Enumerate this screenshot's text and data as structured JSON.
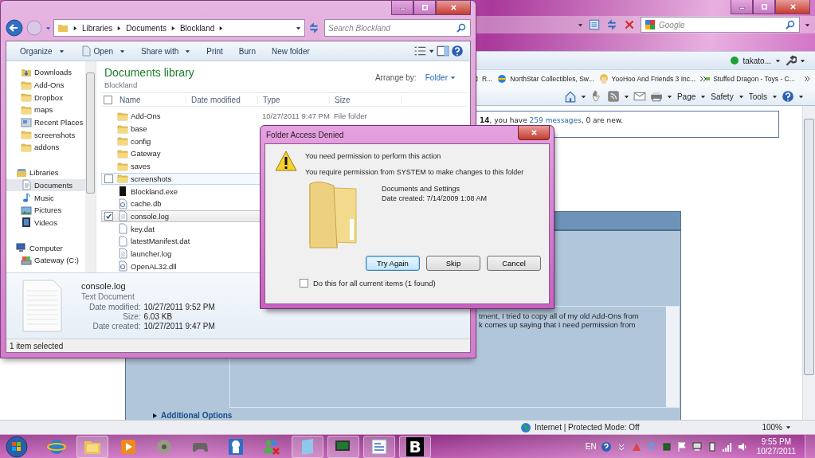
{
  "browser": {
    "search": {
      "placeholder": "Google"
    },
    "user": {
      "name": "takato...",
      "online": true
    },
    "favorites": [
      {
        "label": "R...",
        "kind": "page"
      },
      {
        "label": "NorthStar Collectibles, Sw...",
        "kind": "page"
      },
      {
        "label": "YooHoo And Friends 3 Inc...",
        "kind": "avatar"
      },
      {
        "label": "Stuffed Dragon - Toys - C...",
        "kind": "shop"
      }
    ],
    "command_bar": [
      "Page",
      "Safety",
      "Tools"
    ],
    "welcome": {
      "text": "**14**, you have ",
      "link": "259 messages",
      "rest": ", 0 are new."
    },
    "message_lines": [
      "tment, I tried to copy all of my old Add-Ons from",
      "k comes up saying that I need permission from"
    ],
    "additional_options": "Additional Options",
    "status": {
      "zone": "Internet | Protected Mode: Off",
      "zoom": "100%"
    }
  },
  "explorer": {
    "breadcrumb": [
      "Libraries",
      "Documents",
      "Blockland"
    ],
    "search": {
      "placeholder": "Search Blockland"
    },
    "toolbar": [
      {
        "label": "Organize",
        "dropdown": true,
        "icon": false
      },
      {
        "label": "Open",
        "dropdown": true,
        "icon": true
      },
      {
        "label": "Share with",
        "dropdown": true,
        "icon": false
      },
      {
        "label": "Print",
        "dropdown": false,
        "icon": false
      },
      {
        "label": "Burn",
        "dropdown": false,
        "icon": false
      },
      {
        "label": "New folder",
        "dropdown": false,
        "icon": false
      }
    ],
    "favorites": [
      {
        "label": "Downloads",
        "kind": "downloads",
        "selected": false
      },
      {
        "label": "Add-Ons",
        "kind": "folder",
        "selected": false
      },
      {
        "label": "Dropbox",
        "kind": "folder",
        "selected": false
      },
      {
        "label": "maps",
        "kind": "folder",
        "selected": false
      },
      {
        "label": "Recent Places",
        "kind": "recent",
        "selected": false
      },
      {
        "label": "screenshots",
        "kind": "folder",
        "selected": false
      },
      {
        "label": "addons",
        "kind": "folder",
        "selected": false
      }
    ],
    "groups": [
      {
        "label": "Libraries",
        "kind": "libraries",
        "children": [
          {
            "label": "Documents",
            "kind": "documents",
            "selected": true
          },
          {
            "label": "Music",
            "kind": "music",
            "selected": false
          },
          {
            "label": "Pictures",
            "kind": "pictures",
            "selected": false
          },
          {
            "label": "Videos",
            "kind": "videos",
            "selected": false
          }
        ]
      },
      {
        "label": "Computer",
        "kind": "computer",
        "children": [
          {
            "label": "Gateway (C:)",
            "kind": "drive",
            "selected": false
          }
        ]
      }
    ],
    "library": {
      "title": "Documents library",
      "subtitle": "Blockland",
      "arrange_label": "Arrange by:",
      "arrange_value": "Folder"
    },
    "columns": [
      "Name",
      "Date modified",
      "Type",
      "Size"
    ],
    "select_all_checked": false,
    "files": [
      {
        "name": "Add-Ons",
        "kind": "folder",
        "date": "10/27/2011 9:47 PM",
        "type": "File folder",
        "hovered": false,
        "selected": false
      },
      {
        "name": "base",
        "kind": "folder",
        "hovered": false,
        "selected": false
      },
      {
        "name": "config",
        "kind": "folder",
        "hovered": false,
        "selected": false
      },
      {
        "name": "Gateway",
        "kind": "folder",
        "hovered": false,
        "selected": false
      },
      {
        "name": "saves",
        "kind": "folder",
        "hovered": false,
        "selected": false
      },
      {
        "name": "screenshots",
        "kind": "folder",
        "hovered": true,
        "selected": false
      },
      {
        "name": "Blockland.exe",
        "kind": "exe",
        "hovered": false,
        "selected": false
      },
      {
        "name": "cache.db",
        "kind": "system",
        "hovered": false,
        "selected": false
      },
      {
        "name": "console.log",
        "kind": "text",
        "hovered": false,
        "selected": true
      },
      {
        "name": "key.dat",
        "kind": "blank",
        "hovered": false,
        "selected": false
      },
      {
        "name": "latestManifest.dat",
        "kind": "blank",
        "hovered": false,
        "selected": false
      },
      {
        "name": "launcher.log",
        "kind": "text",
        "hovered": false,
        "selected": false
      },
      {
        "name": "OpenAL32.dll",
        "kind": "system",
        "hovered": false,
        "selected": false
      }
    ],
    "details": {
      "name": "console.log",
      "type": "Text Document",
      "props": [
        {
          "label": "Date modified:",
          "value": "10/27/2011 9:52 PM"
        },
        {
          "label": "Size:",
          "value": "6.03 KB"
        },
        {
          "label": "Date created:",
          "value": "10/27/2011 9:47 PM"
        }
      ]
    },
    "status": "1 item selected"
  },
  "dialog": {
    "title": "Folder Access Denied",
    "heading": "You need permission to perform this action",
    "message": "You require permission from SYSTEM to make changes to this folder",
    "item": {
      "name": "Documents and Settings",
      "date": "Date created: 7/14/2009 1:08 AM"
    },
    "buttons": [
      {
        "label": "Try Again",
        "default": true
      },
      {
        "label": "Skip",
        "default": false
      },
      {
        "label": "Cancel",
        "default": false
      }
    ],
    "checkbox": {
      "label": "Do this for all current items (1 found)",
      "checked": false
    }
  },
  "taskbar": {
    "apps": [
      {
        "kind": "ie",
        "running": false
      },
      {
        "kind": "explorer",
        "running": true
      },
      {
        "kind": "media",
        "running": false
      },
      {
        "kind": "disc",
        "running": false
      },
      {
        "kind": "gamepad",
        "running": false
      },
      {
        "kind": "character",
        "running": false
      },
      {
        "kind": "messenger",
        "running": false
      },
      {
        "kind": "notepad",
        "running": true
      },
      {
        "kind": "monitor",
        "running": true
      },
      {
        "kind": "document",
        "running": true
      },
      {
        "kind": "letter",
        "label": "B",
        "running": true
      }
    ],
    "language": "EN",
    "time": "9:55 PM",
    "date": "10/27/2011"
  }
}
